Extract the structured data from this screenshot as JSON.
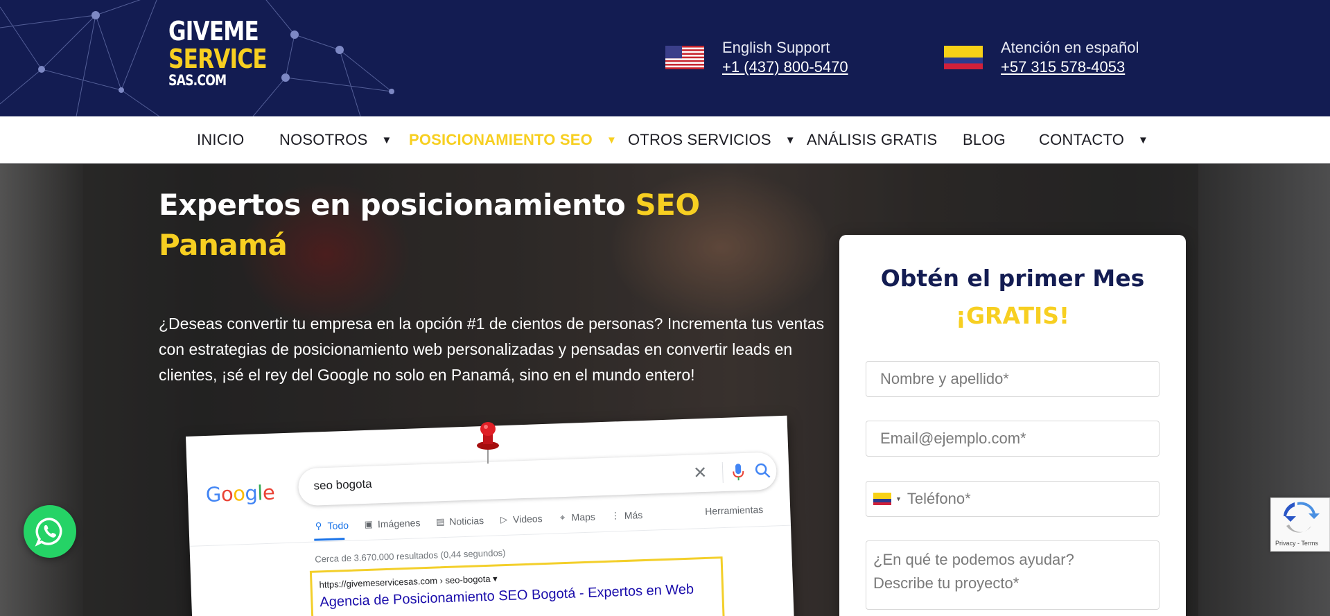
{
  "header": {
    "logo": {
      "line1": "GIVEME",
      "line2": "SERVICE",
      "line3": "SAS.COM"
    },
    "english_support": {
      "label": "English Support",
      "phone": "+1 (437) 800-5470",
      "flag": "us-flag-icon"
    },
    "spanish_support": {
      "label": "Atención en español",
      "phone": "+57 315 578-4053",
      "flag": "colombia-flag-icon"
    }
  },
  "nav": {
    "items": [
      {
        "label": "INICIO",
        "has_dropdown": false
      },
      {
        "label": "NOSOTROS",
        "has_dropdown": true
      },
      {
        "label": "POSICIONAMIENTO SEO",
        "has_dropdown": true,
        "active": true
      },
      {
        "label": "OTROS SERVICIOS",
        "has_dropdown": true
      },
      {
        "label": "ANÁLISIS GRATIS",
        "has_dropdown": false
      },
      {
        "label": "BLOG",
        "has_dropdown": false
      },
      {
        "label": "CONTACTO",
        "has_dropdown": true
      }
    ],
    "dropdown_glyph": "▼"
  },
  "hero": {
    "title_part1": "Expertos en posicionamiento ",
    "title_highlight1": "SEO",
    "title_highlight2": "Panamá",
    "lead": "¿Deseas convertir tu empresa en la opción #1 de cientos de personas? Incrementa tus ventas con estrategias de posicionamiento web personalizadas y pensadas en convertir leads en clientes, ¡sé el rey del Google no solo en Panamá, sino en el mundo entero!"
  },
  "google_mock": {
    "logo": "Google",
    "query": "seo bogota",
    "tabs": [
      {
        "label": "Todo",
        "icon": "search-icon",
        "active": true
      },
      {
        "label": "Imágenes",
        "icon": "image-icon"
      },
      {
        "label": "Noticias",
        "icon": "news-icon"
      },
      {
        "label": "Videos",
        "icon": "video-icon"
      },
      {
        "label": "Maps",
        "icon": "map-pin-icon"
      },
      {
        "label": "Más",
        "icon": "more-icon"
      }
    ],
    "tools": "Herramientas",
    "stats": "Cerca de 3.670.000 resultados (0,44 segundos)",
    "result_url": "https://givemeservicesas.com › seo-bogota ▾",
    "result_title": "Agencia de Posicionamiento SEO Bogotá - Expertos en Web"
  },
  "form": {
    "title": "Obtén el primer Mes",
    "title_highlight": "¡GRATIS!",
    "name_placeholder": "Nombre y apellido*",
    "email_placeholder": "Email@ejemplo.com*",
    "phone_placeholder": "Teléfono*",
    "message_placeholder_line1": "¿En qué te podemos ayudar?",
    "message_placeholder_line2": "Describe tu proyecto*"
  },
  "recaptcha": {
    "links": "Privacy - Terms"
  },
  "colors": {
    "navy": "#131c52",
    "yellow": "#f7cf21",
    "whatsapp": "#25d366"
  }
}
